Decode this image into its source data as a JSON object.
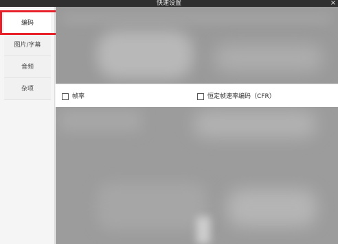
{
  "window": {
    "title": "快速设置",
    "close_icon": "×"
  },
  "sidebar": {
    "items": [
      {
        "label": "编码",
        "active": true
      },
      {
        "label": "图片/字幕",
        "active": false
      },
      {
        "label": "音频",
        "active": false
      },
      {
        "label": "杂项",
        "active": false
      }
    ]
  },
  "options": [
    {
      "label": "帧率",
      "checked": false
    },
    {
      "label": "恒定帧速率编码（CFR）",
      "checked": false
    }
  ],
  "colors": {
    "titlebar": "#2f2f2f",
    "highlight_border": "#e8202a",
    "blurred_area": "#9c9c9c"
  }
}
